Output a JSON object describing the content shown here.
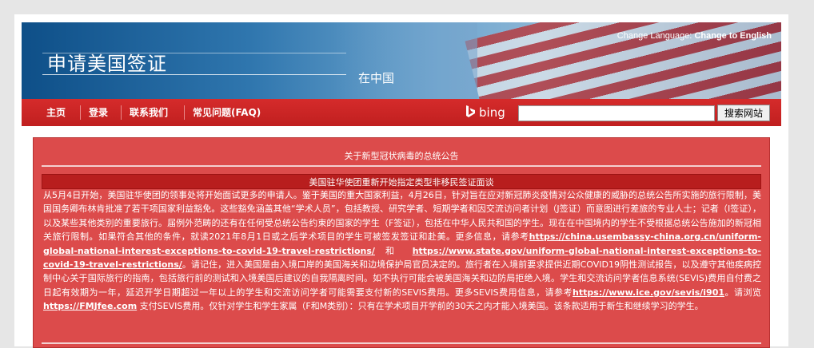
{
  "banner": {
    "title": "申请美国签证",
    "subtitle": "在中国",
    "change_language_label": "Change Language:",
    "change_language_link": "Change to English"
  },
  "nav": {
    "items": [
      {
        "label": "主页"
      },
      {
        "label": "登录"
      },
      {
        "label": "联系我们"
      },
      {
        "label": "常见问题(FAQ)"
      }
    ],
    "bing_label": "bing",
    "search_value": "",
    "search_button": "搜索网站"
  },
  "notice": {
    "title": "关于新型冠状病毒的总统公告",
    "subtitle": "美国驻华使团重新开始指定类型非移民签证面谈",
    "text_1": "从5月4日开始，美国驻华使团的领事处将开始面试更多的申请人。鉴于美国的重大国家利益，4月26日，针对旨在应对新冠肺炎疫情对公众健康的威胁的总统公告所实施的旅行限制，美国国务卿布林肯批准了若干项国家利益豁免。这些豁免涵盖其他“学术人员”，包括教授、研究学者、短期学者和因交流访问者计划（J签证）而意图进行差旅的专业人士；记者（I签证），以及某些其他类别的重要旅行。届例外范畴的还有在任何受总统公告约束的国家的学生（F签证），包括在中华人民共和国的学生。现在在中国境内的学生不受根据总统公告施加的新冠相关旅行限制。如果符合其他的条件，就读2021年8月1日或之后学术项目的学生可被签发签证和赴美。更多信息，请参考",
    "link_1": "https://china.usembassy-china.org.cn/uniform-global-national-interest-exceptions-to-covid-19-travel-restrictions/",
    "text_2": " 和 ",
    "link_2": "https://www.state.gov/uniform-global-national-interest-exceptions-to-covid-19-travel-restrictions/",
    "text_3": "。请记住，进入美国是由入境口岸的美国海关和边境保护局官员决定的。旅行者在入境前要求提供近期COVID19阴性测试报告，以及遵守其他疾病控制中心关于国际旅行的指南，包括旅行前的测试和入境美国后建议的自我隔离时间。如不执行可能会被美国海关和边防局拒绝入境。学生和交流访问学者信息系统(SEVIS)费用自付费之日起有效期为一年，延迟开学日期超过一年以上的学生和交流访问学者可能需要支付新的SEVIS费用。更多SEVIS费用信息，请参考",
    "link_3": "https://www.ice.gov/sevis/i901",
    "text_4": "。请浏览",
    "link_4": "https://FMJfee.com",
    "text_5": " 支付SEVIS费用。仅针对学生和学生家属（F和M类别）：只有在学术项目开学前的30天之内才能入境美国。该条款适用于新生和继续学习的学生。"
  }
}
